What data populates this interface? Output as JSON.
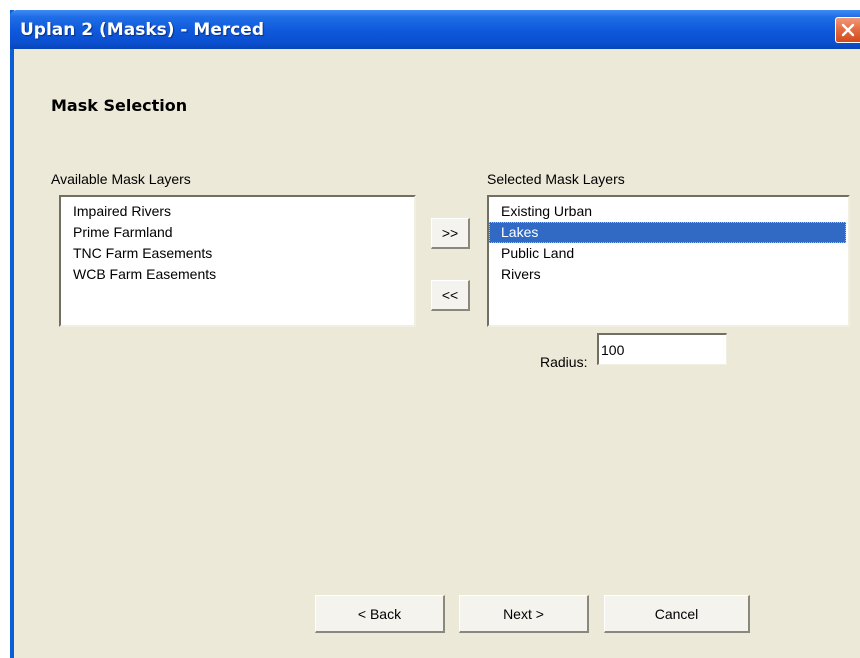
{
  "window": {
    "title": "Uplan 2 (Masks) - Merced"
  },
  "page": {
    "heading": "Mask Selection"
  },
  "available": {
    "label": "Available Mask Layers",
    "items": [
      "Impaired Rivers",
      "Prime Farmland",
      "TNC Farm Easements",
      "WCB Farm Easements"
    ]
  },
  "selected": {
    "label": "Selected Mask Layers",
    "items": [
      "Existing Urban",
      "Lakes",
      "Public Land",
      "Rivers"
    ],
    "selected_item": "Lakes"
  },
  "transfer": {
    "add_label": ">>",
    "remove_label": "<<"
  },
  "radius": {
    "label": "Radius:",
    "value": "100"
  },
  "footer": {
    "back_label": "< Back",
    "next_label": "Next >",
    "cancel_label": "Cancel"
  },
  "colors": {
    "titlebar": "#0a4fcf",
    "dialog_bg": "#ece9d8",
    "selection": "#316ac5",
    "close_button": "#e36a3e"
  },
  "icons": {
    "close": "close-x-icon"
  }
}
